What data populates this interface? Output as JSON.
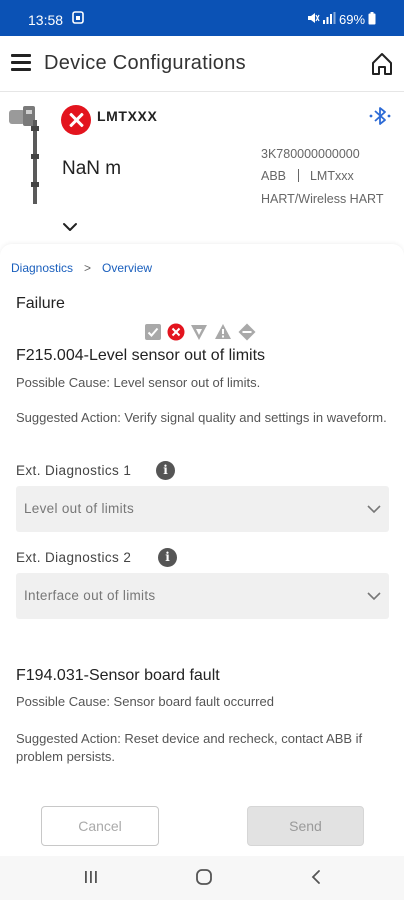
{
  "status_bar": {
    "time": "13:58",
    "battery": "69%"
  },
  "app_bar": {
    "title": "Device Configurations"
  },
  "device": {
    "name": "LMTXXX",
    "value": "NaN m",
    "serial": "3K780000000000",
    "manufacturer": "ABB",
    "model": "LMTxxx",
    "protocol": "HART/Wireless HART"
  },
  "breadcrumb": {
    "parent": "Diagnostics",
    "current": "Overview"
  },
  "section": {
    "title": "Failure"
  },
  "faults": [
    {
      "code": "F215.004-Level sensor out of limits",
      "cause": "Possible Cause: Level sensor out of limits.",
      "action": "Suggested Action: Verify signal quality and settings in waveform."
    },
    {
      "code": "F194.031-Sensor board fault",
      "cause": "Possible Cause: Sensor board fault occurred",
      "action": "Suggested Action: Reset device and recheck, contact ABB if problem persists."
    }
  ],
  "ext_diag": [
    {
      "label": "Ext. Diagnostics 1",
      "value": "Level out of limits"
    },
    {
      "label": "Ext. Diagnostics 2",
      "value": "Interface out of limits"
    }
  ],
  "actions": {
    "cancel": "Cancel",
    "send": "Send"
  },
  "info_glyph": "i",
  "icons": {
    "status": [
      "checkbox-icon",
      "failure-x-icon",
      "filter-triangle-icon",
      "warning-triangle-icon",
      "diamond-icon"
    ],
    "bluetooth": "bluetooth-icon",
    "home": "home-icon",
    "menu": "menu-icon"
  },
  "colors": {
    "status_bar": "#0b52b5",
    "error": "#e3141e",
    "link": "#1a5fbd",
    "bluetooth": "#2d6bd6"
  }
}
